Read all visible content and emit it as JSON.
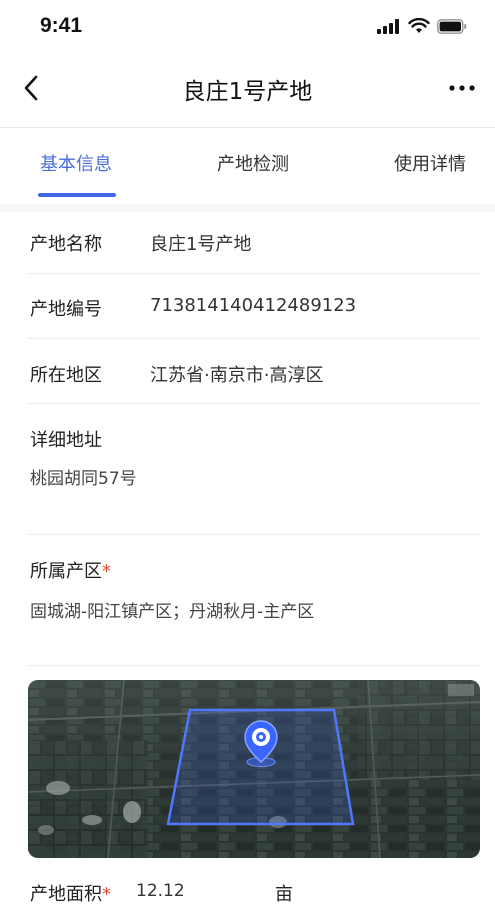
{
  "status_bar": {
    "time": "9:41"
  },
  "nav": {
    "title": "良庄1号产地"
  },
  "tabs": [
    {
      "label": "基本信息"
    },
    {
      "label": "产地检测"
    },
    {
      "label": "使用详情"
    }
  ],
  "fields": {
    "name": {
      "label": "产地名称",
      "value": "良庄1号产地"
    },
    "code": {
      "label": "产地编号",
      "value": "713814140412489123"
    },
    "region": {
      "label": "所在地区",
      "value": "江苏省·南京市·高淳区"
    },
    "address": {
      "label": "详细地址",
      "value": "桃园胡同57号"
    },
    "zone": {
      "label": "所属产区",
      "required_mark": "*",
      "value": "固城湖-阳江镇产区；丹湖秋月-主产区"
    },
    "area": {
      "label": "产地面积",
      "required_mark": "*",
      "value": "12.12",
      "unit": "亩"
    }
  },
  "colors": {
    "accent": "#3f67e6",
    "required": "#e8492e",
    "map_outline": "#4f78ff"
  }
}
